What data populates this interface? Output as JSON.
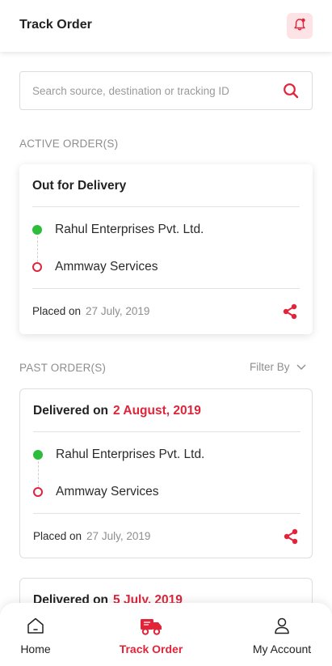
{
  "header": {
    "title": "Track Order",
    "bell_icon": "bell-icon"
  },
  "search": {
    "placeholder": "Search source, destination or tracking ID",
    "value": ""
  },
  "sections": {
    "active_label": "ACTIVE ORDER(S)",
    "past_label": "PAST ORDER(S)",
    "filter_label": "Filter By"
  },
  "active_order": {
    "status": "Out for Delivery",
    "source": "Rahul Enterprises Pvt. Ltd.",
    "destination": "Ammway Services",
    "placed_label": "Placed on",
    "placed_date": "27 July, 2019"
  },
  "past_orders": [
    {
      "status_label": "Delivered on",
      "status_date": "2 August, 2019",
      "source": "Rahul Enterprises Pvt. Ltd.",
      "destination": "Ammway Services",
      "placed_label": "Placed on",
      "placed_date": "27 July, 2019"
    },
    {
      "status_label": "Delivered on",
      "status_date": "5 July, 2019"
    }
  ],
  "nav": [
    {
      "label": "Home",
      "icon": "home-icon"
    },
    {
      "label": "Track Order",
      "icon": "truck-icon",
      "active": true
    },
    {
      "label": "My Account",
      "icon": "user-icon"
    }
  ],
  "colors": {
    "accent": "#e0243a",
    "source_dot": "#2ebd3b",
    "muted": "#8e8e8e"
  }
}
